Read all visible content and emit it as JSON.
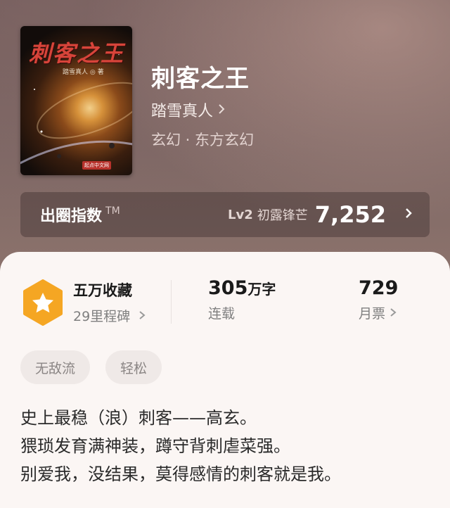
{
  "book": {
    "cover_title": "刺客之王",
    "cover_author": "踏雪真人 ◎ 著",
    "cover_publisher": "起点中文网",
    "title": "刺客之王",
    "author": "踏雪真人",
    "genre": "玄幻 · 东方玄幻"
  },
  "rank": {
    "title": "出圈指数",
    "tm": "TM",
    "level": "Lv2",
    "level_name": "初露锋芒",
    "score": "7,252"
  },
  "stats": {
    "favorites": "五万收藏",
    "milestones": "29里程碑",
    "word_count_number": "305",
    "word_count_unit": "万字",
    "status": "连载",
    "monthly_tickets": "729",
    "monthly_tickets_label": "月票"
  },
  "tags": [
    "无敌流",
    "轻松"
  ],
  "description": [
    "史上最稳（浪）刺客——高玄。",
    "猥琐发育满神装，蹲守背刺虐菜强。",
    "别爱我，没结果，莫得感情的刺客就是我。"
  ],
  "icons": {
    "chevron": "chevron-right-icon",
    "badge": "star-hexagon-icon"
  },
  "colors": {
    "badge_orange": "#f5a623",
    "panel_bg": "#fbf6f4",
    "tag_bg": "#efe9e7"
  }
}
